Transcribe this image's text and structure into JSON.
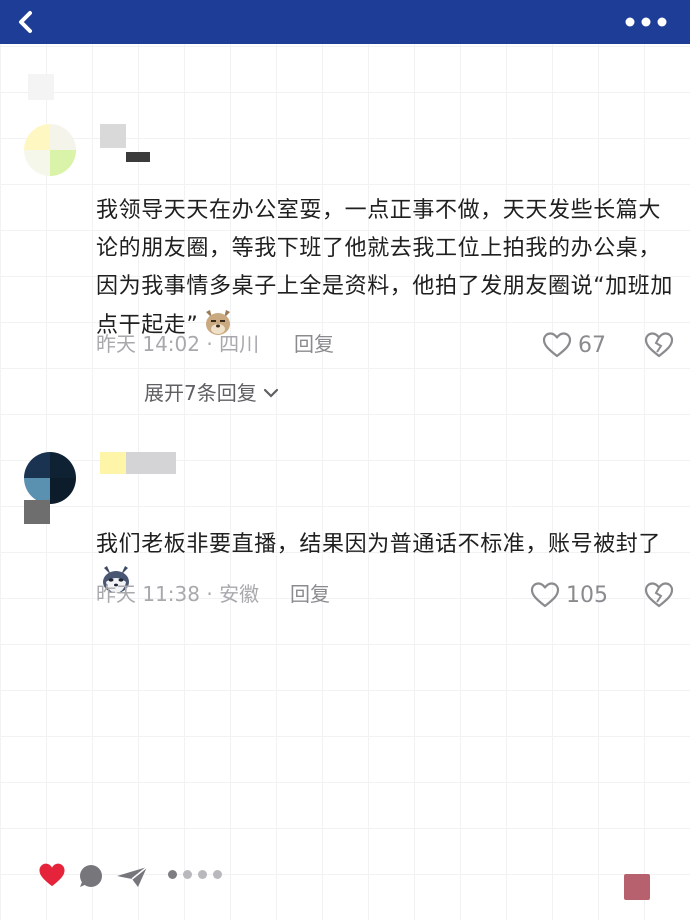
{
  "header": {
    "back_icon": "chevron-left-icon",
    "more_icon": "more-dots-icon",
    "bg_color": "#1d3d96"
  },
  "comments": [
    {
      "text": "我领导天天在办公室耍，一点正事不做，天天发些长篇大论的朋友圈，等我下班了他就去我工位上拍我的办公桌，因为我事情多桌子上全是资料，他拍了发朋友圈说“加班加点干起走”",
      "emoji": "dog-face-emoji",
      "meta": "昨天 14:02 · 四川",
      "reply_label": "回复",
      "likes": "67",
      "expand_label": "展开7条回复"
    },
    {
      "text": "我们老板非要直播，结果因为普通话不标准，账号被封了",
      "emoji": "husky-face-emoji",
      "meta": "昨天 11:38 · 安徽",
      "reply_label": "回复",
      "likes": "105"
    }
  ],
  "bottom_bar": {
    "icons": [
      "heart-icon",
      "comment-bubble-icon",
      "share-arrow-icon",
      "page-dots-icon"
    ],
    "heart_color": "#e5243b"
  }
}
